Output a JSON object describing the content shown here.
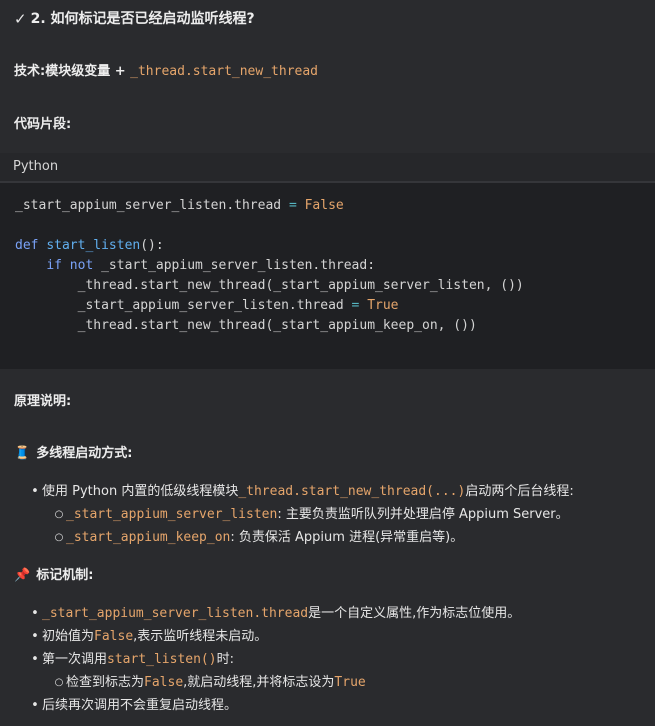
{
  "heading": {
    "icon": "check-icon",
    "text": "2. 如何标记是否已经启动监听线程?"
  },
  "tech": {
    "label": "技术:模块级变量 + ",
    "code": "_thread.start_new_thread"
  },
  "snippet_label": "代码片段:",
  "code": {
    "language": "Python",
    "lines": [
      "_start_appium_server_listen.thread = False",
      "",
      "def start_listen():",
      "    if not _start_appium_server_listen.thread:",
      "        _thread.start_new_thread(_start_appium_server_listen, ())",
      "        _start_appium_server_listen.thread = True",
      "        _thread.start_new_thread(_start_appium_keep_on, ())"
    ]
  },
  "principle_label": "原理说明:",
  "multithread": {
    "icon": "spool-icon",
    "title": "多线程启动方式:",
    "item1_pre": "使用 Python 内置的低级线程模块 ",
    "item1_code": "_thread.start_new_thread(...)",
    "item1_post": " 启动两个后台线程:",
    "sub1_code": "_start_appium_server_listen",
    "sub1_text": ": 主要负责监听队列并处理启停 Appium Server。",
    "sub2_code": "_start_appium_keep_on",
    "sub2_text": ": 负责保活 Appium 进程(异常重启等)。"
  },
  "marker": {
    "icon": "pushpin-icon",
    "title": "标记机制:",
    "item1_code": "_start_appium_server_listen.thread",
    "item1_text": " 是一个自定义属性,作为标志位使用。",
    "item2_pre": "初始值为 ",
    "item2_code": "False",
    "item2_post": ",表示监听线程未启动。",
    "item3_pre": "第一次调用 ",
    "item3_code": "start_listen()",
    "item3_post": " 时:",
    "sub_pre": "检查到标志为 ",
    "sub_code1": "False",
    "sub_mid": ",就启动线程,并将标志设为 ",
    "sub_code2": "True",
    "item4": "后续再次调用不会重复启动线程。"
  },
  "colors": {
    "inline_code": "#e5a56b",
    "background": "#2a2b2e",
    "code_bg": "#1f2023"
  }
}
